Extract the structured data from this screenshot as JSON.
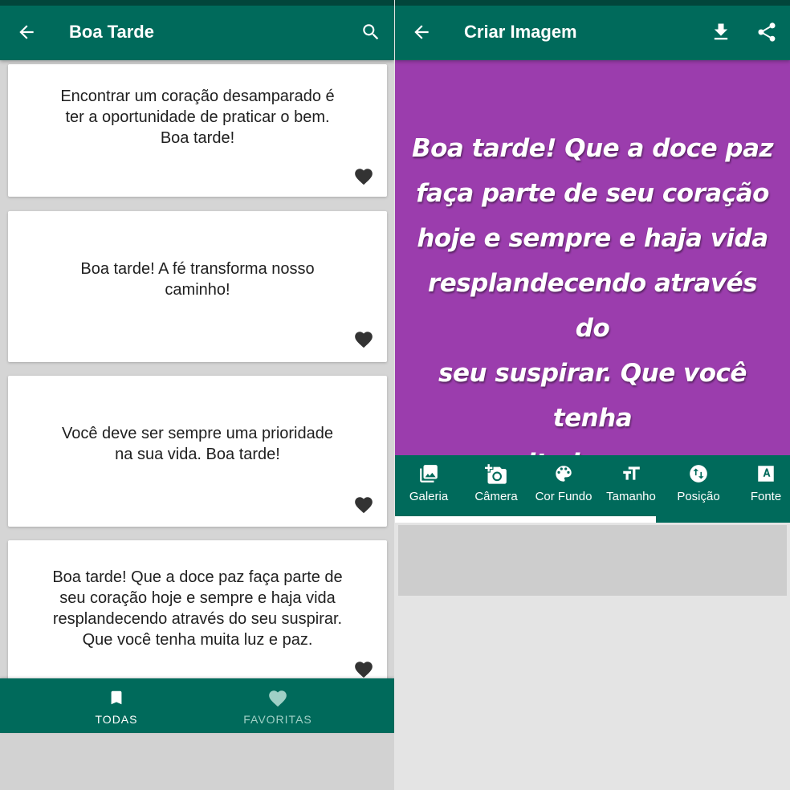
{
  "left_screen": {
    "appbar": {
      "title": "Boa Tarde",
      "back_icon": "arrow-left-icon",
      "search_icon": "search-icon"
    },
    "cards": [
      {
        "text_lines": [
          "Encontrar um coração desamparado é",
          "ter a oportunidade de praticar o bem.",
          "Boa tarde!"
        ],
        "favorite_icon": "heart-icon"
      },
      {
        "text_lines": [
          "Boa tarde! A fé transforma nosso",
          "caminho!"
        ],
        "favorite_icon": "heart-icon"
      },
      {
        "text_lines": [
          "Você deve ser sempre uma prioridade",
          "na sua vida. Boa tarde!"
        ],
        "favorite_icon": "heart-icon"
      },
      {
        "text_lines": [
          "Boa tarde! Que a doce paz faça parte de",
          "seu coração hoje e sempre e haja vida",
          "resplandecendo através do seu suspirar.",
          "Que você tenha muita luz e paz."
        ],
        "favorite_icon": "heart-icon"
      }
    ],
    "bottom_nav": {
      "items": [
        {
          "label": "TODAS",
          "icon": "bookmark-icon",
          "active": true
        },
        {
          "label": "FAVORITAS",
          "icon": "heart-icon",
          "active": false
        }
      ]
    }
  },
  "right_screen": {
    "appbar": {
      "title": "Criar Imagem",
      "back_icon": "arrow-left-icon",
      "download_icon": "download-icon",
      "share_icon": "share-icon"
    },
    "image_preview": {
      "background_color": "#9b3dad",
      "text_lines": [
        "Boa tarde! Que a doce paz",
        "faça parte de seu coração",
        "hoje e sempre e haja vida",
        "resplandecendo através do",
        "seu suspirar. Que você tenha",
        "muita luz e paz."
      ]
    },
    "tools": [
      {
        "label": "Galeria",
        "icon": "gallery-icon"
      },
      {
        "label": "Câmera",
        "icon": "camera-add-icon"
      },
      {
        "label": "Cor Fundo",
        "icon": "palette-icon"
      },
      {
        "label": "Tamanho",
        "icon": "text-size-icon"
      },
      {
        "label": "Posição",
        "icon": "swap-vertical-icon"
      },
      {
        "label": "Fonte",
        "icon": "font-icon"
      }
    ],
    "tools_scroll_fraction": 0.66
  },
  "colors": {
    "primary": "#006a5b",
    "primary_dark": "#02453b",
    "nav_inactive": "#9fd0c6",
    "icon_dark": "#333333",
    "preview_bg": "#9b3dad"
  }
}
